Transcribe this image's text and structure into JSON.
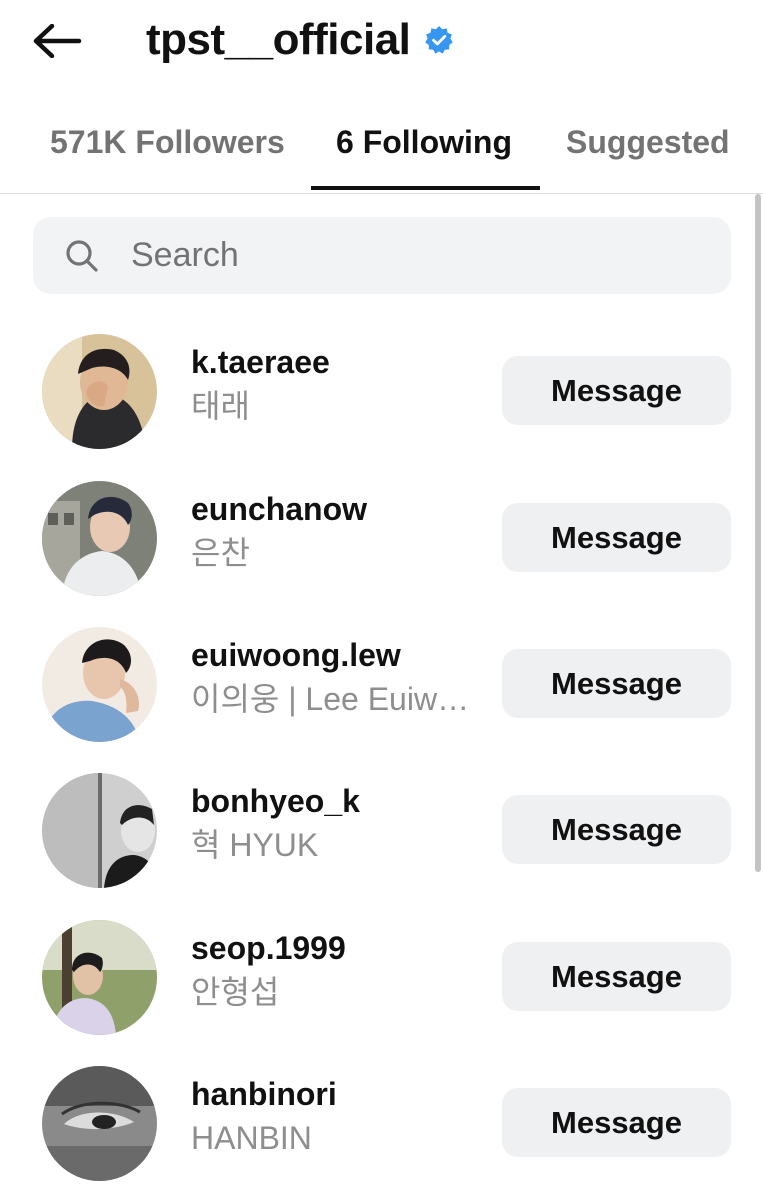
{
  "header": {
    "back_icon": "arrow-left-icon",
    "title": "tpst__official",
    "verified_icon": "verified-badge-icon",
    "verified_color": "#3797f0"
  },
  "tabs": [
    {
      "label": "571K Followers",
      "active": false
    },
    {
      "label": "6 Following",
      "active": true
    },
    {
      "label": "Suggested",
      "active": false
    }
  ],
  "search": {
    "icon": "search-icon",
    "placeholder": "Search",
    "value": ""
  },
  "following": [
    {
      "username": "k.taeraee",
      "name": "태래",
      "action": "Message"
    },
    {
      "username": "eunchanow",
      "name": "은찬",
      "action": "Message"
    },
    {
      "username": "euiwoong.lew",
      "name": "이의웅 | Lee Euiwoong",
      "action": "Message"
    },
    {
      "username": "bonhyeo_k",
      "name": "혁 HYUK",
      "action": "Message"
    },
    {
      "username": "seop.1999",
      "name": "안형섭",
      "action": "Message"
    },
    {
      "username": "hanbinori",
      "name": "HANBIN",
      "action": "Message"
    }
  ]
}
